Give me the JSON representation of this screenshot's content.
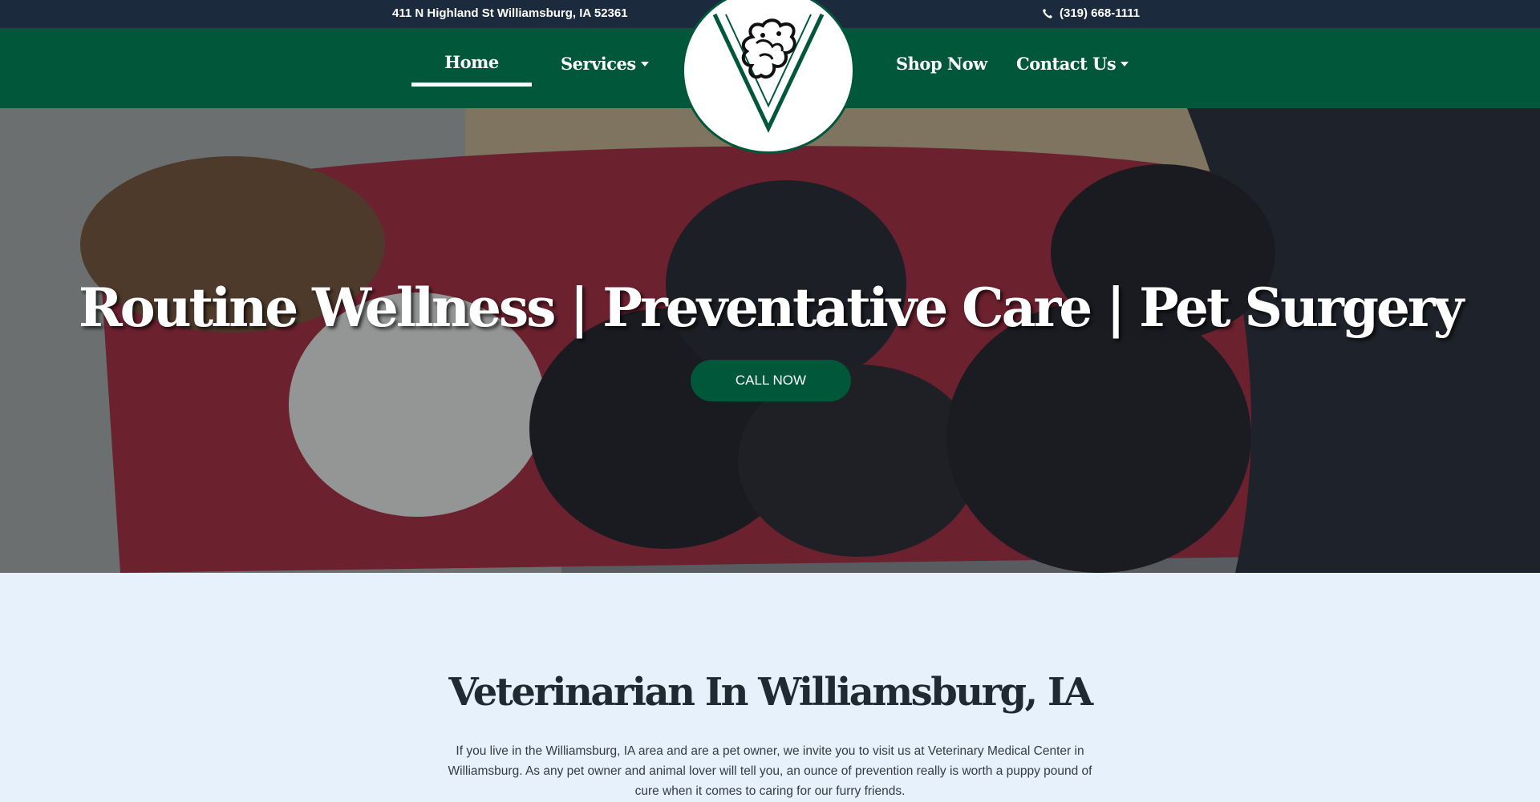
{
  "topbar": {
    "address": "411 N Highland St Williamsburg, IA 52361",
    "phone": "(319) 668-1111",
    "icons": {
      "phone": "phone-icon"
    }
  },
  "nav": {
    "items": [
      {
        "label": "Home",
        "active": true
      },
      {
        "label": "Services",
        "has_dropdown": true
      },
      {
        "label": "Shop Now"
      },
      {
        "label": "Contact Us",
        "has_dropdown": true
      }
    ]
  },
  "logo": {
    "icon": "veterinary-logo-icon"
  },
  "hero": {
    "title": "Routine Wellness | Preventative Care | Pet Surgery",
    "cta_label": "CALL NOW"
  },
  "intro": {
    "title": "Veterinarian In Williamsburg, IA",
    "text": "If you live in the Williamsburg, IA area and are a pet owner, we invite you to visit us at Veterinary Medical Center in Williamsburg. As any pet owner and animal lover will tell you, an ounce of prevention really is worth a puppy pound of cure when it comes to caring for our furry friends."
  },
  "colors": {
    "topbar": "#1b2a3d",
    "brand_green": "#00573a",
    "page_background": "#e6f1fc",
    "heading_text": "#1f2a33"
  }
}
